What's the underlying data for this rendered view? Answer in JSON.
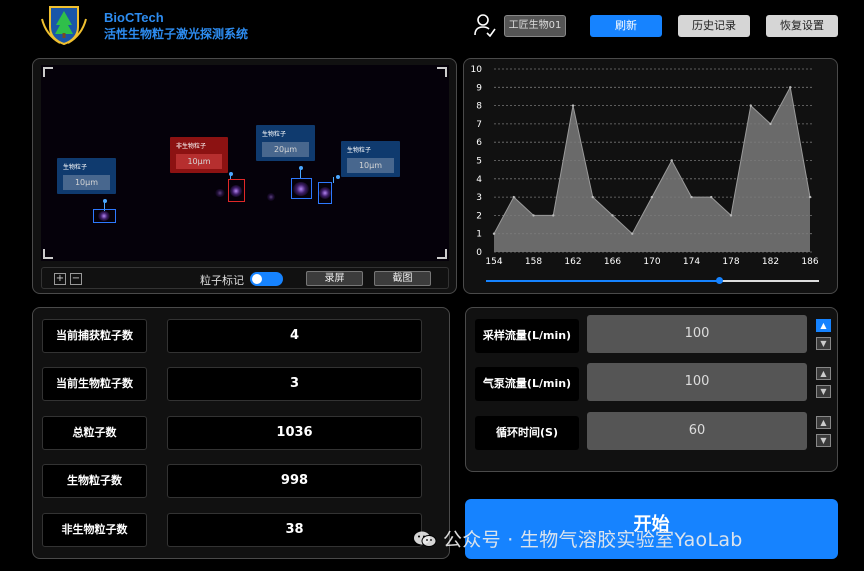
{
  "app": {
    "brand": "BioCTech",
    "title": "活性生物粒子激光探测系统"
  },
  "header": {
    "user": "工匠生物01",
    "refresh": "刷新",
    "history": "历史记录",
    "reset": "恢复设置"
  },
  "camera": {
    "tags": [
      {
        "name": "生物粒子",
        "size": "10μm",
        "kind": "bio"
      },
      {
        "name": "非生物粒子",
        "size": "10μm",
        "kind": "nonbio"
      },
      {
        "name": "生物粒子",
        "size": "20μm",
        "kind": "bio"
      },
      {
        "name": "生物粒子",
        "size": "10μm",
        "kind": "bio"
      }
    ],
    "zoom_in": "+",
    "zoom_out": "−",
    "mark_label": "粒子标记",
    "mark_on": true,
    "record": "录屏",
    "screenshot": "截图"
  },
  "chart_data": {
    "type": "area",
    "x": [
      154,
      156,
      158,
      160,
      162,
      164,
      166,
      168,
      170,
      172,
      174,
      176,
      178,
      180,
      182,
      184,
      186
    ],
    "values": [
      1,
      3,
      2,
      2,
      8,
      3,
      2,
      1,
      3,
      5,
      3,
      3,
      2,
      8,
      7,
      9,
      3
    ],
    "x_ticks": [
      154,
      158,
      162,
      166,
      170,
      174,
      178,
      182,
      186
    ],
    "y_ticks": [
      0,
      1,
      2,
      3,
      4,
      5,
      6,
      7,
      8,
      9,
      10
    ],
    "ylim": [
      0,
      10
    ],
    "xlim": [
      154,
      186
    ],
    "grid": "horizontal-dashed",
    "fill_color": "#7a7a7a",
    "slider_position": 0.7
  },
  "stats": [
    {
      "label": "当前捕获粒子数",
      "value": "4"
    },
    {
      "label": "当前生物粒子数",
      "value": "3"
    },
    {
      "label": "总粒子数",
      "value": "1036"
    },
    {
      "label": "生物粒子数",
      "value": "998"
    },
    {
      "label": "非生物粒子数",
      "value": "38"
    }
  ],
  "controls": [
    {
      "label": "采样流量(L/min)",
      "value": "100"
    },
    {
      "label": "气泵流量(L/min)",
      "value": "100"
    },
    {
      "label": "循环时间(S)",
      "value": "60"
    }
  ],
  "start": "开始",
  "watermark": "公众号 · 生物气溶胶实验室YaoLab",
  "colors": {
    "accent": "#1683ff",
    "nonbio": "#8c1212",
    "bio_tag": "#0f3a6e"
  }
}
